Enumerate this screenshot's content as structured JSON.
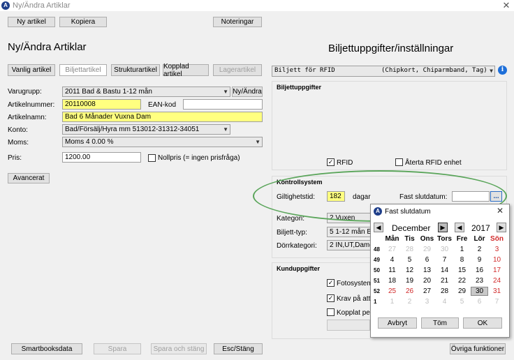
{
  "window": {
    "title": "Ny/Ändra Artiklar",
    "close_glyph": "✕",
    "app_icon_letter": "A"
  },
  "toolbar": {
    "new": "Ny artikel",
    "copy": "Kopiera",
    "notes": "Noteringar"
  },
  "left": {
    "heading": "Ny/Ändra Artiklar",
    "tabs": [
      "Vanlig artikel",
      "Biljettartikel",
      "Strukturartikel",
      "Kopplad artikel",
      "Lagerartikel"
    ],
    "labels": {
      "varugrupp": "Varugrupp:",
      "artikelnummer": "Artikelnummer:",
      "artikelnamn": "Artikelnamn:",
      "konto": "Konto:",
      "moms": "Moms:",
      "pris": "Pris:",
      "ean": "EAN-kod"
    },
    "values": {
      "varugrupp": "2011 Bad & Bastu 1-12 mån",
      "artikelnummer": "20110008",
      "artikelnamn": "Bad 6 Månader Vuxna Dam",
      "konto": "Bad/Försälj/Hyra mm 513012-31312-34051",
      "moms": "Moms 4  0.00 %",
      "pris": "1200.00",
      "ean": ""
    },
    "ny_andra": "Ny/Ändra",
    "nollpris": "Nollpris (= ingen prisfråga)",
    "avancerat": "Avancerat"
  },
  "right": {
    "heading": "Biljettuppgifter/inställningar",
    "ticket_type": "Biljett för RFID",
    "ticket_type_hint": "(Chipkort, Chiparmband, Tag)",
    "biljett_group": "Biljettuppgifter",
    "rfid": "RFID",
    "aterta": "Återta RFID enhet",
    "kontroll_group": "Kontrollsystem",
    "giltighet_label": "Giltighetstid:",
    "giltighet_value": "182",
    "dagar": "dagar",
    "fast_slutdatum": "Fast slutdatum:",
    "ellipsis": "...",
    "kategori_label": "Kategori:",
    "kategori_value": "2 Vuxen",
    "biljett_typ_label": "Biljett-typ:",
    "biljett_typ_value": "5 1-12 mån B",
    "dorr_label": "Dörrkategori:",
    "dorr_value": "2 IN,UT,Dame",
    "kund_group": "Kunduppgifter",
    "fotosystem": "Fotosystem",
    "krav": "Krav på att",
    "kopplat": "Kopplat per"
  },
  "calendar": {
    "title": "Fast slutdatum",
    "month": "December",
    "year": "2017",
    "days": [
      "Mån",
      "Tis",
      "Ons",
      "Tors",
      "Fre",
      "Lör",
      "Sön"
    ],
    "weeks": [
      {
        "wn": "48",
        "d": [
          "27",
          "28",
          "29",
          "30",
          "1",
          "2",
          "3"
        ],
        "other": [
          true,
          true,
          true,
          true,
          false,
          false,
          false
        ]
      },
      {
        "wn": "49",
        "d": [
          "4",
          "5",
          "6",
          "7",
          "8",
          "9",
          "10"
        ],
        "other": [
          false,
          false,
          false,
          false,
          false,
          false,
          false
        ]
      },
      {
        "wn": "50",
        "d": [
          "11",
          "12",
          "13",
          "14",
          "15",
          "16",
          "17"
        ],
        "other": [
          false,
          false,
          false,
          false,
          false,
          false,
          false
        ]
      },
      {
        "wn": "51",
        "d": [
          "18",
          "19",
          "20",
          "21",
          "22",
          "23",
          "24"
        ],
        "other": [
          false,
          false,
          false,
          false,
          false,
          false,
          false
        ]
      },
      {
        "wn": "52",
        "d": [
          "25",
          "26",
          "27",
          "28",
          "29",
          "30",
          "31"
        ],
        "other": [
          false,
          false,
          false,
          false,
          false,
          false,
          false
        ]
      },
      {
        "wn": "1",
        "d": [
          "1",
          "2",
          "3",
          "4",
          "5",
          "6",
          "7"
        ],
        "other": [
          true,
          true,
          true,
          true,
          true,
          true,
          true
        ]
      }
    ],
    "red_dates": [
      "25",
      "26"
    ],
    "today": "30",
    "avbryt": "Avbryt",
    "tom": "Töm",
    "ok": "OK",
    "close": "✕"
  },
  "bottom": {
    "smartbooks": "Smartbooksdata",
    "spara": "Spara",
    "spara_stang": "Spara och stäng",
    "esc": "Esc/Stäng",
    "ovriga": "Övriga funktioner"
  },
  "colors": {
    "yellow_field": "#ffff80",
    "ellipse": "#5aa55a",
    "sunday": "#d12a2a"
  }
}
